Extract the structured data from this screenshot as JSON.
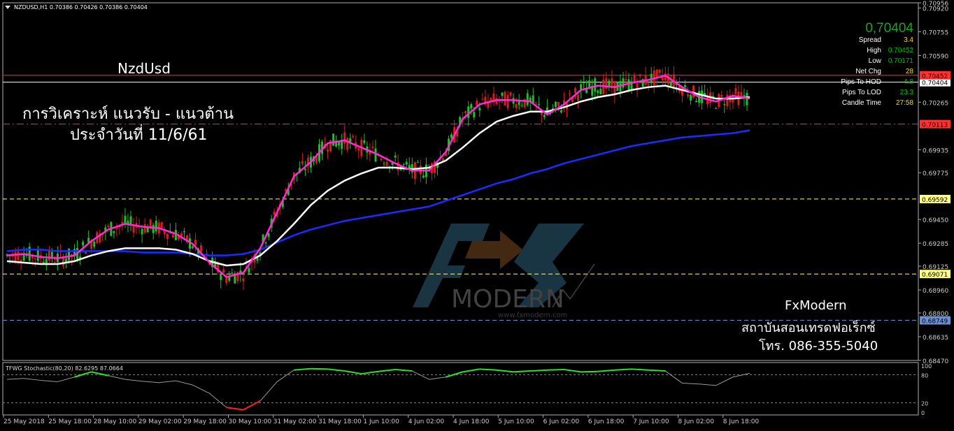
{
  "symbol_header": "NZDUSD,H1  0.70386 0.70426 0.70386 0.70404",
  "title": "NzdUsd",
  "subtitle_line1": "การวิเคราะห์ แนวรับ - แนวต้าน",
  "subtitle_line2": "ประจำวันที่ 11/6/61",
  "branding": {
    "name": "FxModern",
    "school": "สถาบันสอนเทรดฟอเร็กซ์",
    "phone": "โทร. 086-355-5040",
    "watermark_main": "FX",
    "watermark_sub": "MODERN",
    "watermark_url": "www.fxmodern.com"
  },
  "info_panel": {
    "price": "0,70404",
    "rows": [
      {
        "label": "Spread",
        "value": "3.4",
        "color": "#ffd700"
      },
      {
        "label": "High",
        "value": "0.70452",
        "color": "#00c000"
      },
      {
        "label": "Low",
        "value": "0.70171",
        "color": "#00c000"
      },
      {
        "label": "Net Chg",
        "value": "28",
        "color": "#ffd700"
      },
      {
        "label": "Pips To HOD",
        "value": "4.8",
        "color": "#00c000"
      },
      {
        "label": "Pips To LOD",
        "value": "23.3",
        "color": "#00c000"
      },
      {
        "label": "Candle Time",
        "value": "27:58",
        "color": "#ffd700"
      }
    ]
  },
  "oscillator_label": "TFWG Stochastic(80,20) 82.6295 87.0664",
  "chart_data": {
    "type": "line",
    "title": "NzdUsd",
    "ylim": [
      0.6847,
      0.70956
    ],
    "y_ticks": [
      "0.70956",
      "0.70920",
      "0.70755",
      "0.70590",
      "0.70430",
      "0.70265",
      "0.70110",
      "0.69935",
      "0.69775",
      "0.69592",
      "0.69450",
      "0.69285",
      "0.69125",
      "0.69071",
      "0.68960",
      "0.68800",
      "0.68749",
      "0.68635",
      "0.68470"
    ],
    "x_ticks": [
      "25 May 2018",
      "25 May 18:00",
      "28 May 10:00",
      "29 May 02:00",
      "29 May 18:00",
      "30 May 10:00",
      "31 May 02:00",
      "31 May 18:00",
      "1 Jun 10:00",
      "4 Jun 02:00",
      "4 Jun 18:00",
      "5 Jun 10:00",
      "6 Jun 02:00",
      "6 Jun 18:00",
      "7 Jun 10:00",
      "8 Jun 02:00",
      "8 Jun 18:00"
    ],
    "levels": [
      {
        "value": 0.70404,
        "label": "0.70404",
        "color": "#ffffff",
        "style": "solid"
      },
      {
        "value": 0.70452,
        "label": "0.70452",
        "color": "#ff3030",
        "style": "solid"
      },
      {
        "value": 0.70113,
        "label": "0.70113",
        "color": "#ff3030",
        "style": "dashdot"
      },
      {
        "value": 0.69592,
        "label": "0.69592",
        "color": "#ffff80",
        "style": "dashed"
      },
      {
        "value": 0.69071,
        "label": "0.69071",
        "color": "#ffff80",
        "style": "dashed"
      },
      {
        "value": 0.68749,
        "label": "0.68749",
        "color": "#6b8fd6",
        "style": "dashed"
      }
    ],
    "series": [
      {
        "name": "ma_fast",
        "color": "#ff2bd6",
        "values": [
          0.692,
          0.6921,
          0.6919,
          0.6918,
          0.692,
          0.693,
          0.6938,
          0.6942,
          0.694,
          0.6939,
          0.6935,
          0.6928,
          0.6915,
          0.6905,
          0.6908,
          0.6925,
          0.695,
          0.6975,
          0.6985,
          0.6998,
          0.7,
          0.6995,
          0.699,
          0.6984,
          0.6979,
          0.6979,
          0.6992,
          0.7015,
          0.7025,
          0.7028,
          0.7028,
          0.7027,
          0.7018,
          0.7025,
          0.7035,
          0.7038,
          0.7037,
          0.704,
          0.7042,
          0.7045,
          0.7037,
          0.703,
          0.7027,
          0.7031,
          0.7029
        ]
      },
      {
        "name": "ma_mid",
        "color": "#ffffff",
        "values": [
          0.6916,
          0.6915,
          0.6914,
          0.6914,
          0.6916,
          0.692,
          0.6923,
          0.6925,
          0.6925,
          0.6925,
          0.6924,
          0.6921,
          0.6916,
          0.6913,
          0.6914,
          0.692,
          0.693,
          0.6942,
          0.6955,
          0.6965,
          0.6972,
          0.6977,
          0.6981,
          0.6981,
          0.698,
          0.6981,
          0.6986,
          0.6995,
          0.7005,
          0.7013,
          0.7017,
          0.702,
          0.702,
          0.7023,
          0.7027,
          0.703,
          0.7032,
          0.7035,
          0.7037,
          0.7038,
          0.7035,
          0.7032,
          0.7029,
          0.7029,
          0.703
        ]
      },
      {
        "name": "ma_slow",
        "color": "#1c2cff",
        "values": [
          0.6923,
          0.6924,
          0.6924,
          0.6923,
          0.6923,
          0.6923,
          0.6923,
          0.6923,
          0.6922,
          0.6922,
          0.6922,
          0.6921,
          0.692,
          0.692,
          0.6921,
          0.6924,
          0.6929,
          0.6934,
          0.6938,
          0.6941,
          0.6944,
          0.6946,
          0.6948,
          0.695,
          0.6952,
          0.6954,
          0.6958,
          0.6962,
          0.6966,
          0.697,
          0.6973,
          0.6977,
          0.698,
          0.6984,
          0.6987,
          0.699,
          0.6993,
          0.6996,
          0.6998,
          0.7,
          0.7002,
          0.7003,
          0.7004,
          0.7005,
          0.7007
        ]
      }
    ],
    "oscillator": {
      "ylim": [
        0,
        100
      ],
      "levels": [
        80,
        20
      ],
      "values": [
        70,
        72,
        68,
        65,
        75,
        86,
        78,
        70,
        66,
        63,
        67,
        58,
        40,
        10,
        5,
        24,
        65,
        90,
        93,
        92,
        88,
        82,
        87,
        91,
        88,
        70,
        75,
        86,
        92,
        90,
        86,
        88,
        90,
        91,
        86,
        87,
        90,
        92,
        90,
        88,
        62,
        60,
        57,
        75,
        83
      ]
    }
  }
}
